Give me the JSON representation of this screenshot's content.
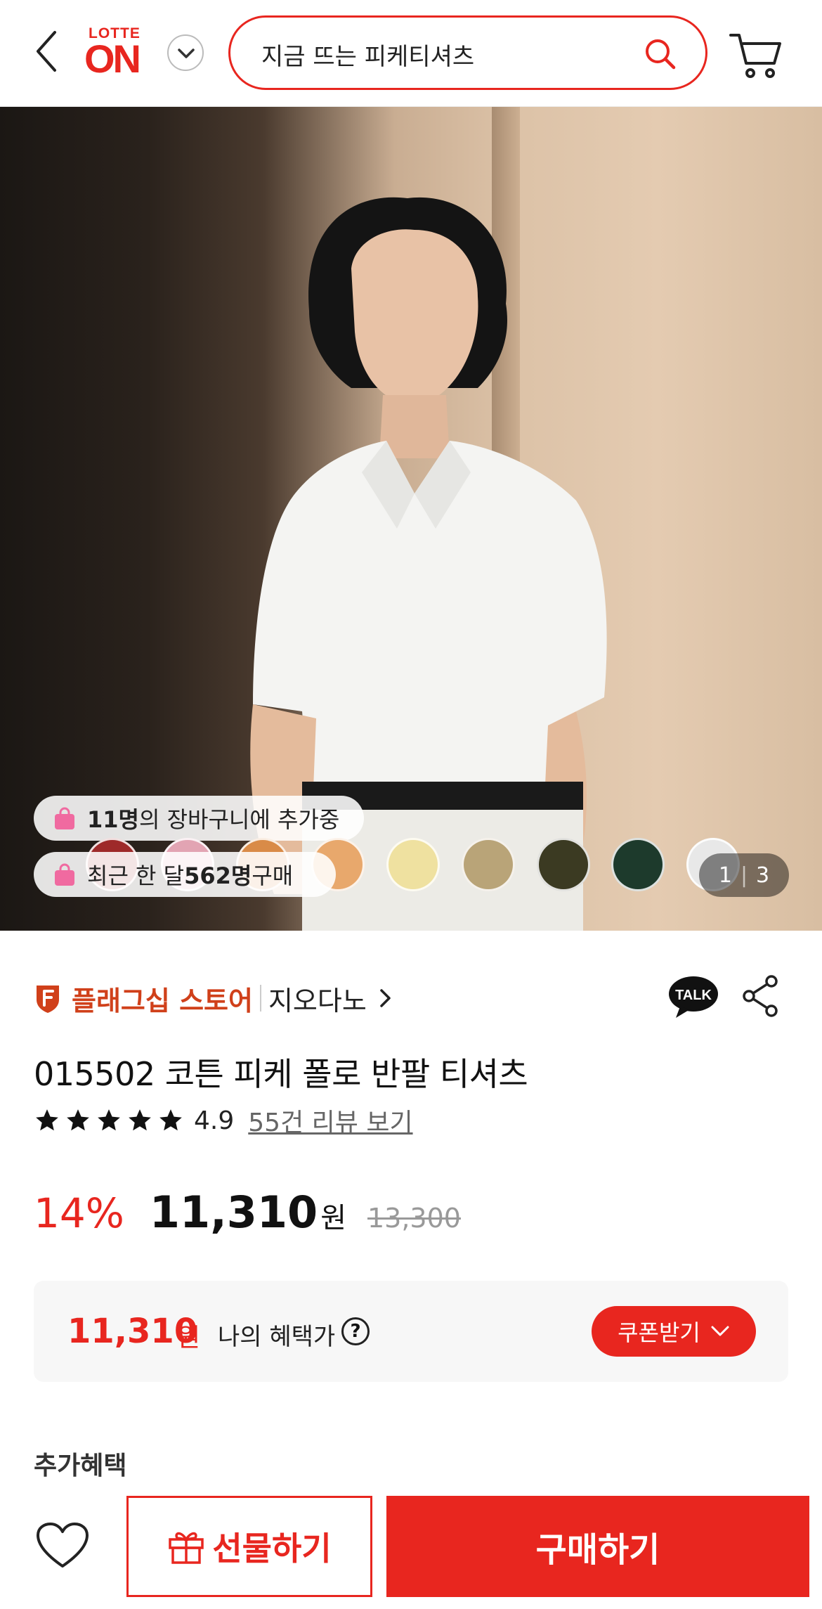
{
  "header": {
    "logo_top": "LOTTE",
    "logo_main": "ON",
    "search_query": "지금 뜨는 피케티셔츠"
  },
  "hero": {
    "cart_stat": {
      "count": "11명",
      "suffix": "의 장바구니에 추가중"
    },
    "purchase_stat": {
      "prefix": "최근 한 달 ",
      "count": "562명",
      "suffix": " 구매"
    },
    "swatches": [
      "#9e2a2a",
      "#e2a4b3",
      "#d98b48",
      "#e8a86c",
      "#efe1a0",
      "#b9a478",
      "#3b3a22",
      "#1d3a2c",
      "#e8e8e8"
    ],
    "counter": {
      "current": "1",
      "separator": "|",
      "total": "3"
    }
  },
  "store": {
    "type": "플래그십 스토어",
    "brand": "지오다노"
  },
  "product": {
    "title": "015502 코튼 피케 폴로 반팔 티셔츠",
    "rating": "4.9",
    "reviews_link": "55건 리뷰 보기",
    "discount": "14%",
    "price": "11,310",
    "currency": "원",
    "original_price": "13,300"
  },
  "benefit": {
    "price": "11,310",
    "currency": "원",
    "label": "나의 혜택가",
    "help": "?",
    "coupon_button": "쿠폰받기"
  },
  "extra_section": "추가혜택",
  "bottom": {
    "gift_label": "선물하기",
    "buy_label": "구매하기"
  },
  "colors": {
    "accent": "#e8261f",
    "flag": "#d0401a"
  }
}
